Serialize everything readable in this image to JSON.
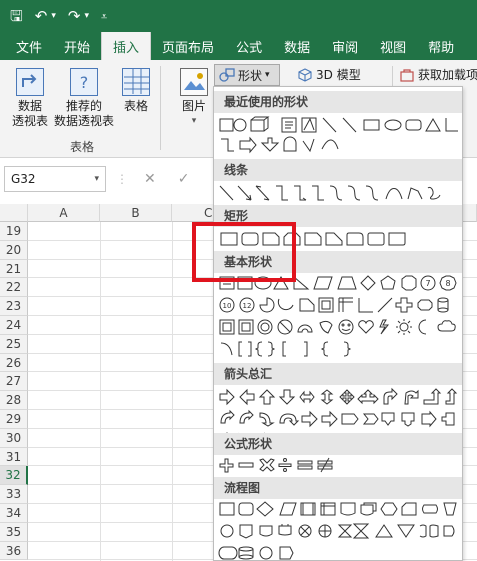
{
  "qat": {
    "save": "🖫",
    "undo": "↶",
    "redo": "↷",
    "dropdown": "▾",
    "customize": "⩡"
  },
  "tabs": [
    {
      "label": "文件"
    },
    {
      "label": "开始"
    },
    {
      "label": "插入"
    },
    {
      "label": "页面布局"
    },
    {
      "label": "公式"
    },
    {
      "label": "数据"
    },
    {
      "label": "审阅"
    },
    {
      "label": "视图"
    },
    {
      "label": "帮助"
    }
  ],
  "ribbon": {
    "pivot": "数据\n透视表",
    "recommended_pivot": "推荐的\n数据透视表",
    "table": "表格",
    "tables_group": "表格",
    "pictures": "图片",
    "shapes": "形状",
    "model3d": "3D 模型",
    "addins": "获取加载项"
  },
  "formula_bar": {
    "name_box": "G32",
    "cancel": "✕",
    "enter": "✓"
  },
  "grid": {
    "columns": [
      "A",
      "B",
      "C"
    ],
    "rows": [
      "19",
      "20",
      "21",
      "22",
      "23",
      "24",
      "25",
      "26",
      "27",
      "28",
      "29",
      "30",
      "31",
      "32",
      "33",
      "34",
      "35",
      "36"
    ],
    "selected_row": "32"
  },
  "shapes_menu": {
    "categories": [
      "最近使用的形状",
      "线条",
      "矩形",
      "基本形状",
      "箭头总汇",
      "公式形状",
      "流程图"
    ]
  },
  "colors": {
    "excel_green": "#217346",
    "highlight_red": "#e0141e"
  }
}
